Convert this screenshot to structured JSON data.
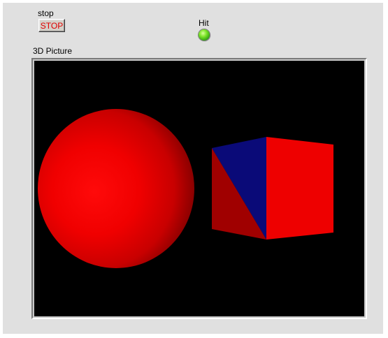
{
  "stop_control": {
    "label": "stop",
    "button_text": "STOP",
    "button_text_color": "#e00000"
  },
  "hit_indicator": {
    "label": "Hit",
    "state": "on",
    "color": "#5ad11c"
  },
  "picture": {
    "label": "3D Picture",
    "background_color": "#000000",
    "objects": [
      {
        "name": "sphere",
        "color": "#ff0000"
      },
      {
        "name": "cube",
        "face_colors": [
          "#ee0000",
          "#0a0a78",
          "#a00000"
        ]
      }
    ]
  }
}
